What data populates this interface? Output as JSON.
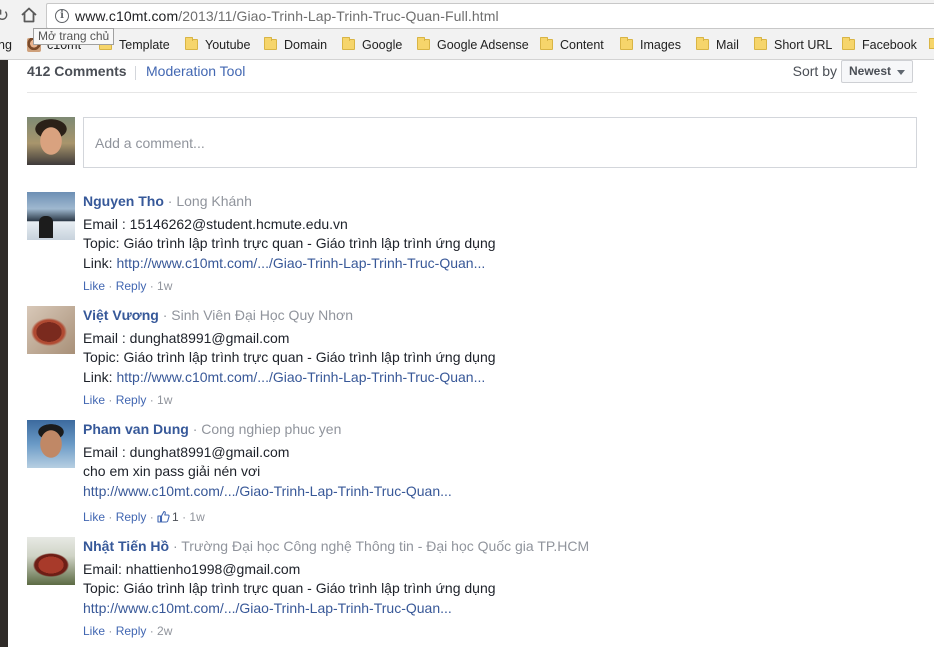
{
  "browser": {
    "url_host": "www.c10mt.com",
    "url_path": "/2013/11/Giao-Trinh-Lap-Trinh-Truc-Quan-Full.html",
    "tooltip": "Mở trang chủ",
    "bookmarks_cut": "ng",
    "bookmarks": [
      {
        "label": "c10mt",
        "icon": "favicon"
      },
      {
        "label": "Template",
        "icon": "folder-icon"
      },
      {
        "label": "Youtube",
        "icon": "folder-icon"
      },
      {
        "label": "Domain",
        "icon": "folder-icon"
      },
      {
        "label": "Google",
        "icon": "folder-icon"
      },
      {
        "label": "Google Adsense",
        "icon": "folder-icon"
      },
      {
        "label": "Content",
        "icon": "folder-icon"
      },
      {
        "label": "Images",
        "icon": "folder-icon"
      },
      {
        "label": "Mail",
        "icon": "folder-icon"
      },
      {
        "label": "Short URL",
        "icon": "folder-icon"
      },
      {
        "label": "Facebook",
        "icon": "folder-icon"
      }
    ]
  },
  "comments_header": {
    "count_label": "412 Comments",
    "moderation_label": "Moderation Tool",
    "sort_label": "Sort by",
    "sort_value": "Newest"
  },
  "composer": {
    "placeholder": "Add a comment..."
  },
  "comments": [
    {
      "name": "Nguyen Tho",
      "subtitle": "· Long Khánh",
      "lines": [
        {
          "text": "Email : 15146262@student.hcmute.edu.vn"
        },
        {
          "text": "Topic: Giáo trình lập trình trực quan - Giáo trình lập trình ứng dụng"
        },
        {
          "prefix": "Link: ",
          "link": "http://www.c10mt.com/.../Giao-Trinh-Lap-Trinh-Truc-Quan..."
        }
      ],
      "like": "Like",
      "reply": "Reply",
      "time": "1w"
    },
    {
      "name": "Việt Vương",
      "subtitle": "· Sinh Viên Đại Học Quy Nhơn",
      "lines": [
        {
          "text": "Email : dunghat8991@gmail.com"
        },
        {
          "text": "Topic: Giáo trình lập trình trực quan - Giáo trình lập trình ứng dụng"
        },
        {
          "prefix": "Link: ",
          "link": "http://www.c10mt.com/.../Giao-Trinh-Lap-Trinh-Truc-Quan..."
        }
      ],
      "like": "Like",
      "reply": "Reply",
      "time": "1w"
    },
    {
      "name": "Pham van Dung",
      "subtitle": "· Cong nghiep phuc yen",
      "lines": [
        {
          "text": "Email : dunghat8991@gmail.com"
        },
        {
          "text": "cho em xin pass giải nén vơi"
        },
        {
          "link": "http://www.c10mt.com/.../Giao-Trinh-Lap-Trinh-Truc-Quan..."
        }
      ],
      "like": "Like",
      "reply": "Reply",
      "likes_count": "1",
      "time": "1w"
    },
    {
      "name": "Nhật Tiến Hồ",
      "subtitle": "· Trường Đại học Công nghệ Thông tin - Đại học Quốc gia TP.HCM",
      "lines": [
        {
          "text": "Email: nhattienho1998@gmail.com"
        },
        {
          "text": "Topic: Giáo trình lập trình trực quan - Giáo trình lập trình ứng dụng"
        },
        {
          "link": "http://www.c10mt.com/.../Giao-Trinh-Lap-Trinh-Truc-Quan..."
        }
      ],
      "like": "Like",
      "reply": "Reply",
      "time": "2w"
    }
  ]
}
